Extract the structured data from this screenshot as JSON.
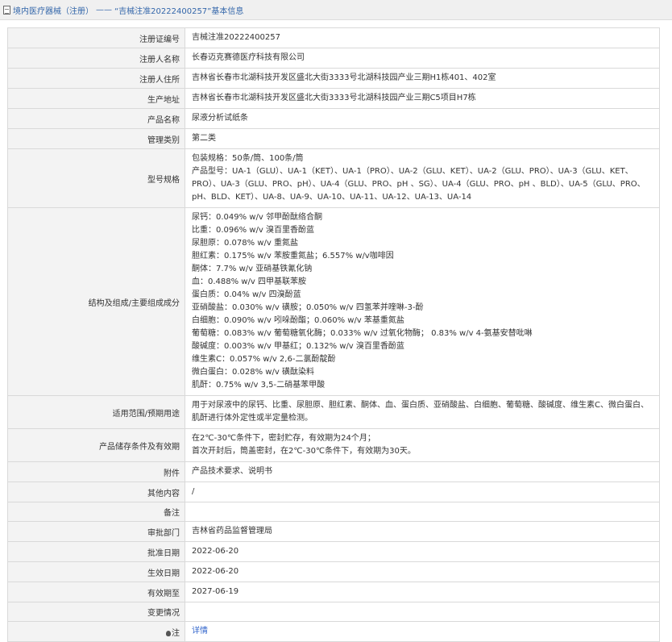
{
  "breadcrumb": {
    "section": "境内医疗器械（注册）",
    "separator": "——",
    "title": "“吉械注准20222400257”基本信息"
  },
  "rows": {
    "reg_no": {
      "label": "注册证编号",
      "value": "吉械注准20222400257"
    },
    "registrant": {
      "label": "注册人名称",
      "value": "长春迈克赛德医疗科技有限公司"
    },
    "reg_addr": {
      "label": "注册人住所",
      "value": "吉林省长春市北湖科技开发区盛北大街3333号北湖科技园产业三期H1栋401、402室"
    },
    "prod_addr": {
      "label": "生产地址",
      "value": "吉林省长春市北湖科技开发区盛北大街3333号北湖科技园产业三期C5项目H7栋"
    },
    "product": {
      "label": "产品名称",
      "value": "尿液分析试纸条"
    },
    "category": {
      "label": "管理类别",
      "value": "第二类"
    },
    "model": {
      "label": "型号规格",
      "lines": [
        "包装规格：50条/筒、100条/筒",
        "产品型号：UA-1（GLU）、UA-1（KET）、UA-1（PRO）、UA-2（GLU、KET）、UA-2（GLU、PRO）、UA-3（GLU、KET、PRO）、UA-3（GLU、PRO、pH）、UA-4（GLU、PRO、pH 、SG）、UA-4（GLU、PRO、pH 、BLD）、UA-5（GLU、PRO、pH、BLD、KET）、UA-8、UA-9、UA-10、UA-11、UA-12、UA-13、UA-14"
      ]
    },
    "composition": {
      "label": "结构及组成/主要组成成分",
      "lines": [
        "尿钙：0.049% w/v 邻甲酚酞络合酮",
        "比重：0.096% w/v 溴百里香酚蓝",
        "尿胆原：0.078% w/v 重氮盐",
        "胆红素：0.175% w/v 苯胺重氮盐；6.557% w/v咖啡因",
        "酮体：7.7% w/v 亚硝基铁氰化钠",
        "血：0.488% w/v 四甲基联苯胺",
        "蛋白质：0.04% w/v 四溴酚蓝",
        "亚硝酸盐：0.030% w/v 磺胺；0.050% w/v 四氢苯并喹啉-3-酚",
        "白细胞：0.090% w/v 吲哚酚酯；0.060% w/v 苯基重氮盐",
        "葡萄糖：0.083% w/v 葡萄糖氧化酶；0.033% w/v 过氧化物酶；  0.83% w/v 4-氨基安替吡啉",
        "酸碱度：0.003% w/v 甲基红；0.132% w/v 溴百里香酚蓝",
        "维生素C：0.057% w/v 2,6-二氯酚靛酚",
        "微白蛋白：0.028% w/v 磺酞染料",
        "肌酐：0.75% w/v 3,5-二硝基苯甲酸"
      ]
    },
    "scope": {
      "label": "适用范围/预期用途",
      "value": "用于对尿液中的尿钙、比重、尿胆原、胆红素、酮体、血、蛋白质、亚硝酸盐、白细胞、葡萄糖、酸碱度、维生素C、微白蛋白、肌酐进行体外定性或半定量检测。"
    },
    "storage": {
      "label": "产品储存条件及有效期",
      "lines": [
        "在2℃-30℃条件下，密封贮存，有效期为24个月；",
        "首次开封后，筒盖密封，在2℃-30℃条件下，有效期为30天。"
      ]
    },
    "attachment": {
      "label": "附件",
      "value": "产品技术要求、说明书"
    },
    "other": {
      "label": "其他内容",
      "value": "/"
    },
    "remark": {
      "label": "备注",
      "value": ""
    },
    "approver": {
      "label": "审批部门",
      "value": "吉林省药品监督管理局"
    },
    "approve_date": {
      "label": "批准日期",
      "value": "2022-06-20"
    },
    "effective_date": {
      "label": "生效日期",
      "value": "2022-06-20"
    },
    "valid_until": {
      "label": "有效期至",
      "value": "2027-06-19"
    },
    "changes": {
      "label": "变更情况",
      "value": ""
    },
    "note": {
      "label": "注",
      "link": "详情",
      "icon": "bulb-icon"
    }
  }
}
